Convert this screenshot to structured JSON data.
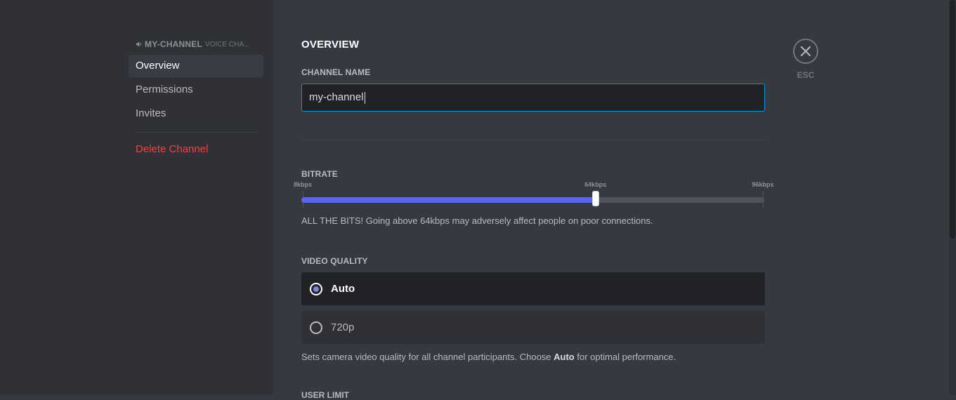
{
  "sidebar": {
    "header": {
      "name": "MY-CHANNEL",
      "subtitle": "VOICE CHA..."
    },
    "items": [
      {
        "label": "Overview",
        "active": true
      },
      {
        "label": "Permissions",
        "active": false
      },
      {
        "label": "Invites",
        "active": false
      }
    ],
    "delete_label": "Delete Channel"
  },
  "overview": {
    "title": "OVERVIEW",
    "channel_name_label": "CHANNEL NAME",
    "channel_name_value": "my-channel"
  },
  "bitrate": {
    "label": "BITRATE",
    "min_label": "8kbps",
    "mid_label": "64kbps",
    "max_label": "96kbps",
    "min": 8,
    "max": 96,
    "value": 64,
    "helper": "ALL THE BITS! Going above 64kbps may adversely affect people on poor connections."
  },
  "video_quality": {
    "label": "VIDEO QUALITY",
    "options": [
      {
        "label": "Auto",
        "selected": true
      },
      {
        "label": "720p",
        "selected": false
      }
    ],
    "helper_prefix": "Sets camera video quality for all channel participants. Choose ",
    "helper_bold": "Auto",
    "helper_suffix": " for optimal performance."
  },
  "next_section_label": "USER LIMIT",
  "close": {
    "esc_label": "ESC",
    "icon": "close-icon"
  },
  "colors": {
    "accent": "#5865f2",
    "danger": "#ed4245",
    "input_border": "#0097d7"
  }
}
